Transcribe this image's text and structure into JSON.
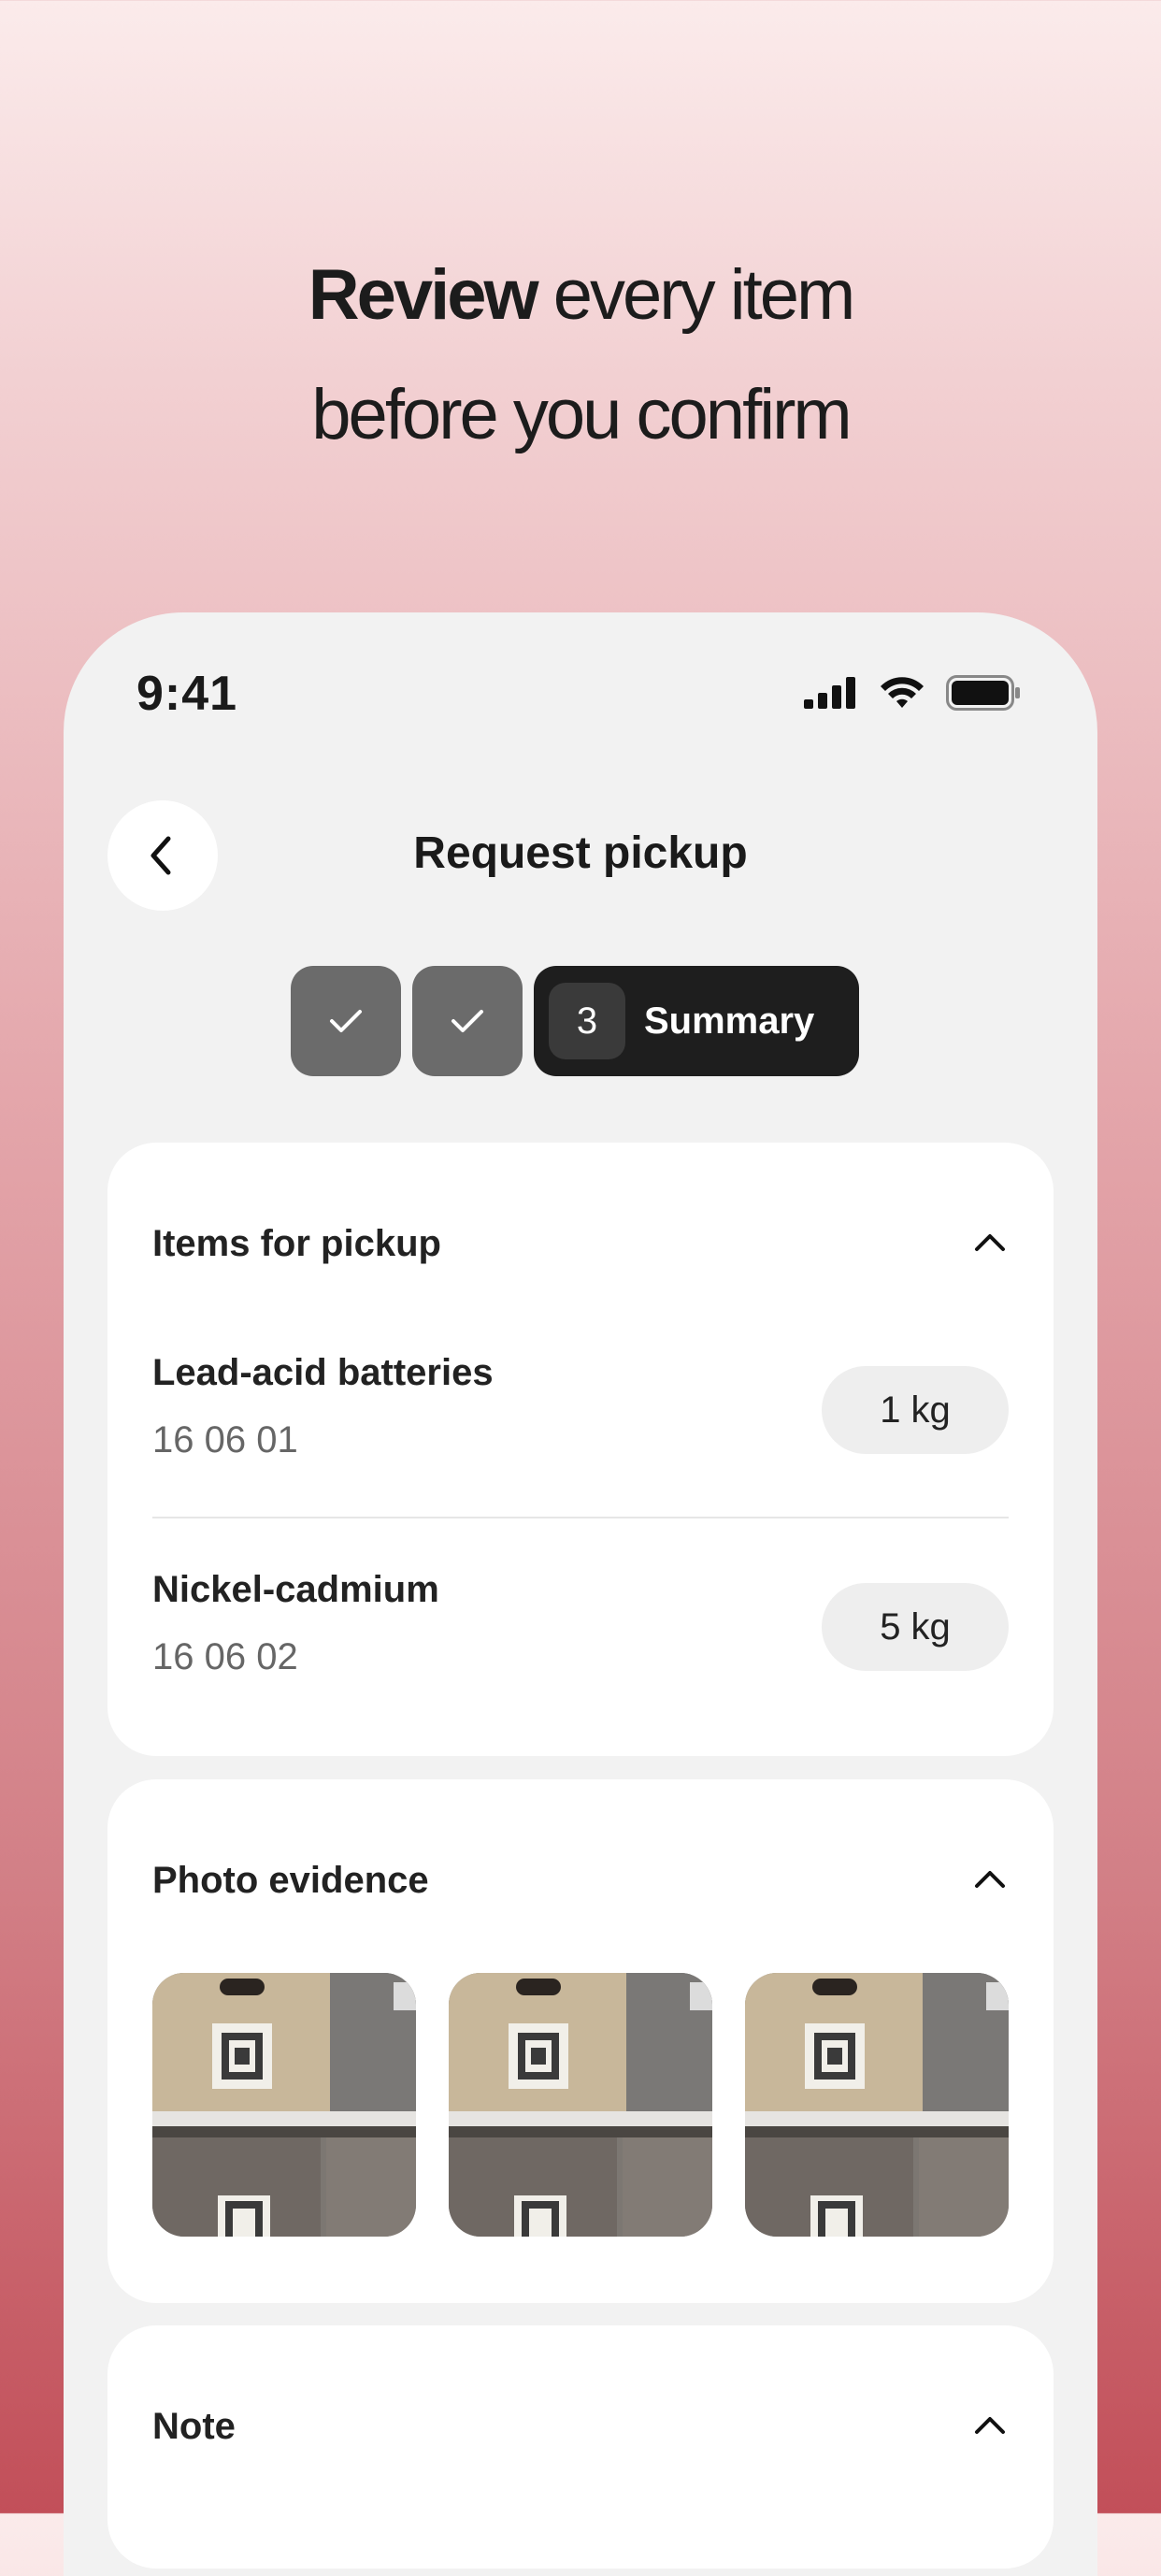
{
  "headline": {
    "bold": "Review",
    "rest_line1": " every item",
    "line2": "before you confirm"
  },
  "status": {
    "time": "9:41"
  },
  "header": {
    "title": "Request pickup"
  },
  "stepper": {
    "active_number": "3",
    "active_label": "Summary",
    "completed_steps": 2
  },
  "items_section": {
    "title": "Items for pickup",
    "items": [
      {
        "name": "Lead-acid batteries",
        "code": "16 06 01",
        "qty": "1 kg"
      },
      {
        "name": "Nickel-cadmium",
        "code": "16 06 02",
        "qty": "5 kg"
      }
    ]
  },
  "photos_section": {
    "title": "Photo evidence",
    "photo_count": 3
  },
  "note_section": {
    "title": "Note"
  },
  "icons": [
    "chevron-left-icon",
    "check-icon",
    "chevron-up-icon",
    "signal-icon",
    "wifi-icon",
    "battery-icon"
  ]
}
